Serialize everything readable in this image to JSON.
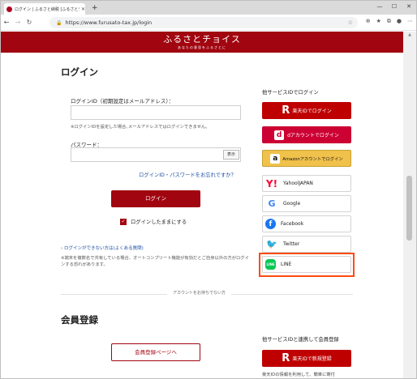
{
  "browser": {
    "tab_title": "ログイン | ふるさと納税 [ふるさとチョイス]",
    "tab_close": "✕",
    "new_tab": "+",
    "url": "https://www.furusato-tax.jp/login",
    "window_controls": [
      "—",
      "☐",
      "✕"
    ]
  },
  "site": {
    "logo": "ふるさとチョイス",
    "tagline": "あなたの意思をふるさとに"
  },
  "login": {
    "heading": "ログイン",
    "id_label": "ログインID（初期設定はメールアドレス）：",
    "id_value": "",
    "id_hint": "※ログインIDを設定した場合､メールアドレスではログインできません。",
    "password_label": "パスワード：",
    "password_value": "",
    "show_button": "表示",
    "forgot_link": "ログインID・パスワードをお忘れですか？",
    "submit": "ログイン",
    "keep_logged_in": "ログインしたままにする",
    "keep_checked": true,
    "faq_link": "› ログインができない方は(よくある質問)",
    "shared_device_note": "※端末を複数名で共有している場合、オートコンプリート機能が有効だとご自身以外の方がログインする恐れがあります。"
  },
  "social": {
    "title": "他サービスIDでログイン",
    "buttons": [
      {
        "label": "楽天IDでログイン",
        "icon": "R"
      },
      {
        "label": "dアカウントでログイン",
        "icon": "d"
      },
      {
        "label": "Amazonアカウントでログイン",
        "icon": "a"
      },
      {
        "label": "YahoolJAPAN",
        "icon": "Y!"
      },
      {
        "label": "Google",
        "icon": "G"
      },
      {
        "label": "Facebook",
        "icon": "f"
      },
      {
        "label": "Twitter",
        "icon": "🐦"
      },
      {
        "label": "LINE",
        "icon": "LINE"
      }
    ]
  },
  "divider_text": "アカウントをお持ちでない方",
  "register": {
    "heading": "会員登録",
    "button": "会員登録ページへ",
    "side_title": "他サービスIDと連携して会員登録",
    "rakuten_button": "楽天IDで新規登録",
    "rakuten_icon": "R",
    "note": "楽天IDの情報を利用して、簡単に寄付"
  },
  "colors": {
    "brand": "#a1050f",
    "rakuten": "#bf0000",
    "docomo": "#cc0033",
    "amazon": "#f0c14b",
    "line": "#06c755",
    "highlight": "#ff4a12"
  }
}
